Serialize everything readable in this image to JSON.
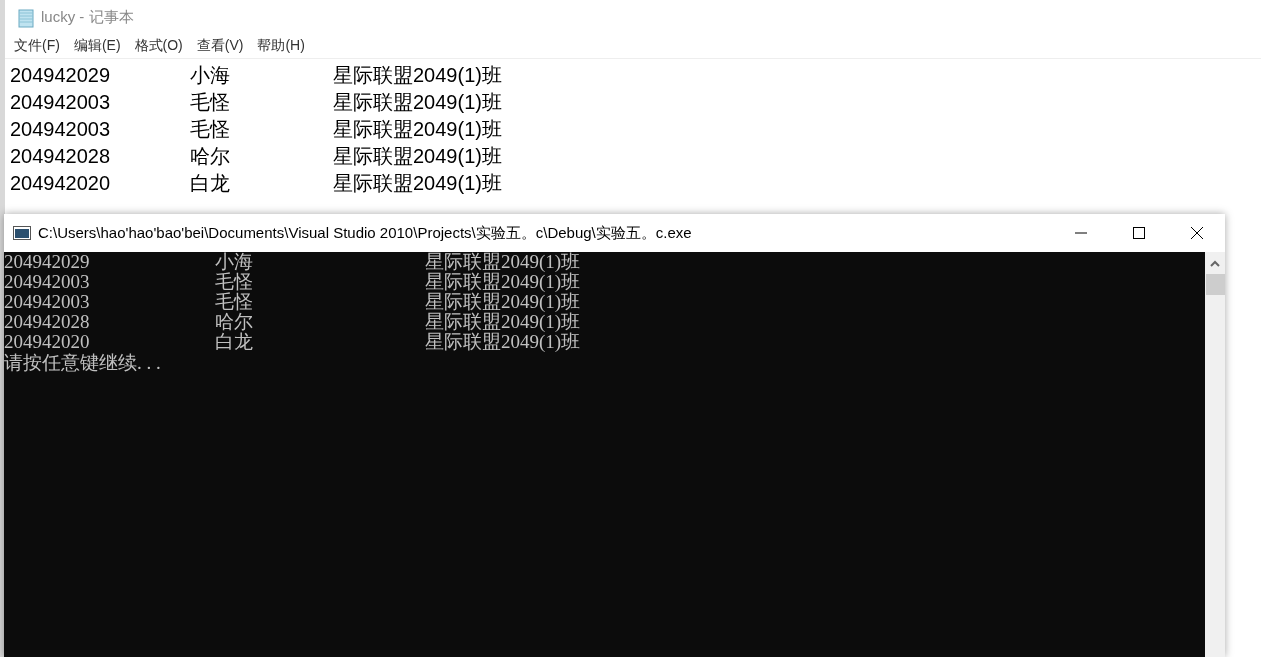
{
  "notepad": {
    "title": "lucky - 记事本",
    "menu": [
      "文件(F)",
      "编辑(E)",
      "格式(O)",
      "查看(V)",
      "帮助(H)"
    ],
    "lines": [
      [
        "204942029",
        "小海",
        "星际联盟2049(1)班"
      ],
      [
        "204942003",
        "毛怪",
        "星际联盟2049(1)班"
      ],
      [
        "204942003",
        "毛怪",
        "星际联盟2049(1)班"
      ],
      [
        "204942028",
        "哈尔",
        "星际联盟2049(1)班"
      ],
      [
        "204942020",
        "白龙",
        "星际联盟2049(1)班"
      ]
    ]
  },
  "console": {
    "title": "C:\\Users\\hao'hao'bao'bei\\Documents\\Visual Studio 2010\\Projects\\实验五。c\\Debug\\实验五。c.exe",
    "rows": [
      [
        "204942029",
        "小海",
        "星际联盟2049(1)班"
      ],
      [
        "204942003",
        "毛怪",
        "星际联盟2049(1)班"
      ],
      [
        "204942003",
        "毛怪",
        "星际联盟2049(1)班"
      ],
      [
        "204942028",
        "哈尔",
        "星际联盟2049(1)班"
      ],
      [
        "204942020",
        "白龙",
        "星际联盟2049(1)班"
      ]
    ],
    "prompt": "请按任意键继续. . ."
  }
}
